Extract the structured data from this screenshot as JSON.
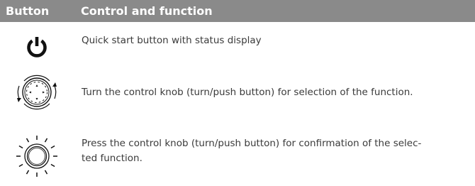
{
  "table": {
    "header": {
      "col_button": "Button",
      "col_control": "Control and function"
    },
    "rows": [
      {
        "icon": "power-icon",
        "text": "Quick start button with status display"
      },
      {
        "icon": "turn-knob-icon",
        "text": "Turn the control knob (turn/push button) for selection of the function."
      },
      {
        "icon": "push-knob-icon",
        "text": "Press the control knob (turn/push button) for confirmation of the selec-\nted function."
      }
    ]
  },
  "colors": {
    "header_bg": "#8a8a8a",
    "header_text": "#ffffff",
    "body_text": "#3a3a3a",
    "icon": "#111111"
  }
}
